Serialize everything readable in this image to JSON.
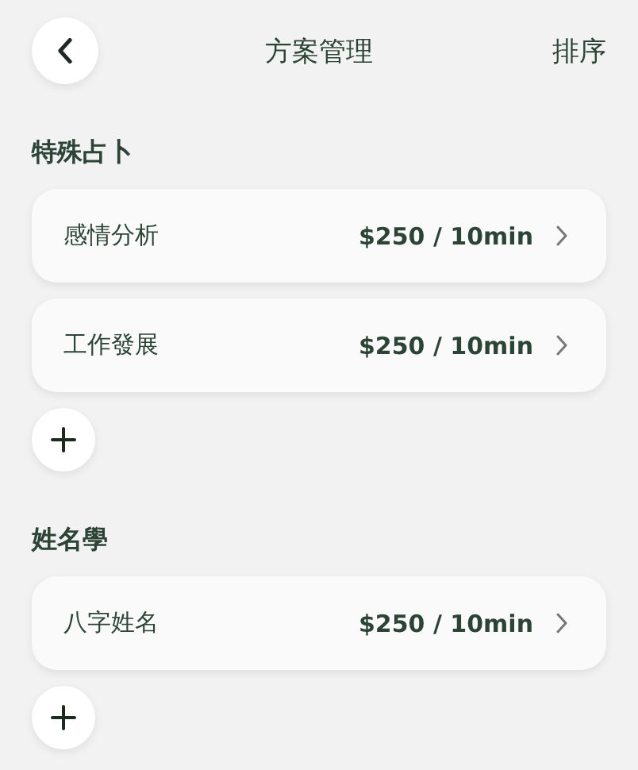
{
  "header": {
    "title": "方案管理",
    "action": "排序"
  },
  "sections": [
    {
      "title": "特殊占卜",
      "plans": [
        {
          "name": "感情分析",
          "price": "$250 / 10min"
        },
        {
          "name": "工作發展",
          "price": "$250 / 10min"
        }
      ]
    },
    {
      "title": "姓名學",
      "plans": [
        {
          "name": "八字姓名",
          "price": "$250 / 10min"
        }
      ]
    }
  ]
}
